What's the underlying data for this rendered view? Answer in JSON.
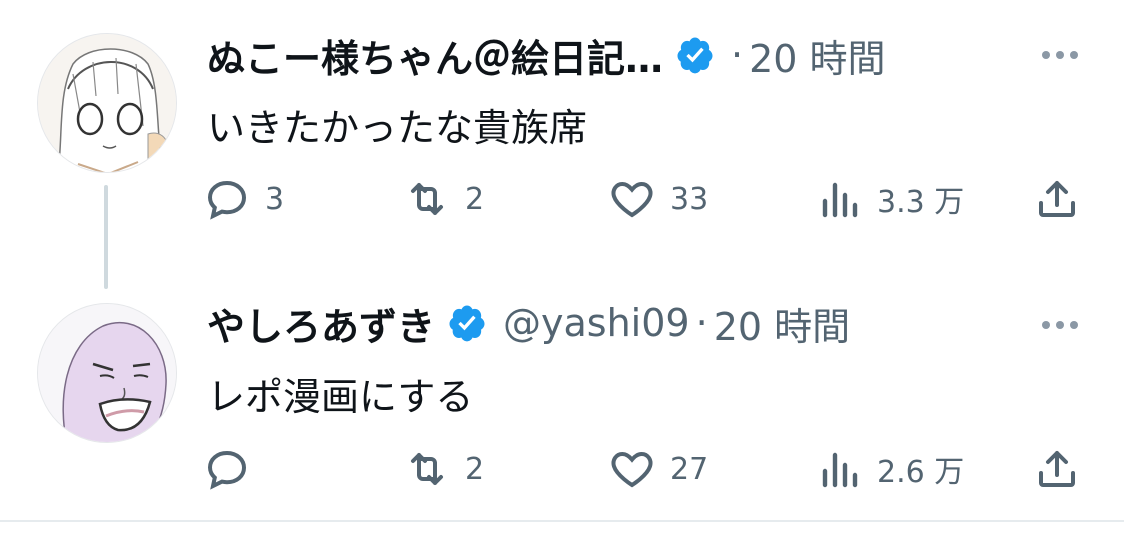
{
  "tweets": [
    {
      "name": "ぬこー様ちゃん＠絵日記…",
      "handle": "",
      "dot": "·",
      "time": "20 時間",
      "text": "いきたかったな貴族席",
      "replies": "3",
      "retweets": "2",
      "likes": "33",
      "views": "3.3 万",
      "avatar": "anime-girl-avatar"
    },
    {
      "name": "やしろあずき",
      "handle": "@yashi09",
      "dot": "·",
      "time": "20 時間",
      "text": "レポ漫画にする",
      "replies": "",
      "retweets": "2",
      "likes": "27",
      "views": "2.6 万",
      "avatar": "purple-face-avatar"
    }
  ],
  "colors": {
    "verified": "#1d9bf0",
    "icon_gray": "#536471",
    "thread_line": "#cfd9de"
  },
  "icons": [
    "reply-icon",
    "retweet-icon",
    "like-icon",
    "views-icon",
    "share-icon",
    "more-icon",
    "verified-badge-icon"
  ]
}
